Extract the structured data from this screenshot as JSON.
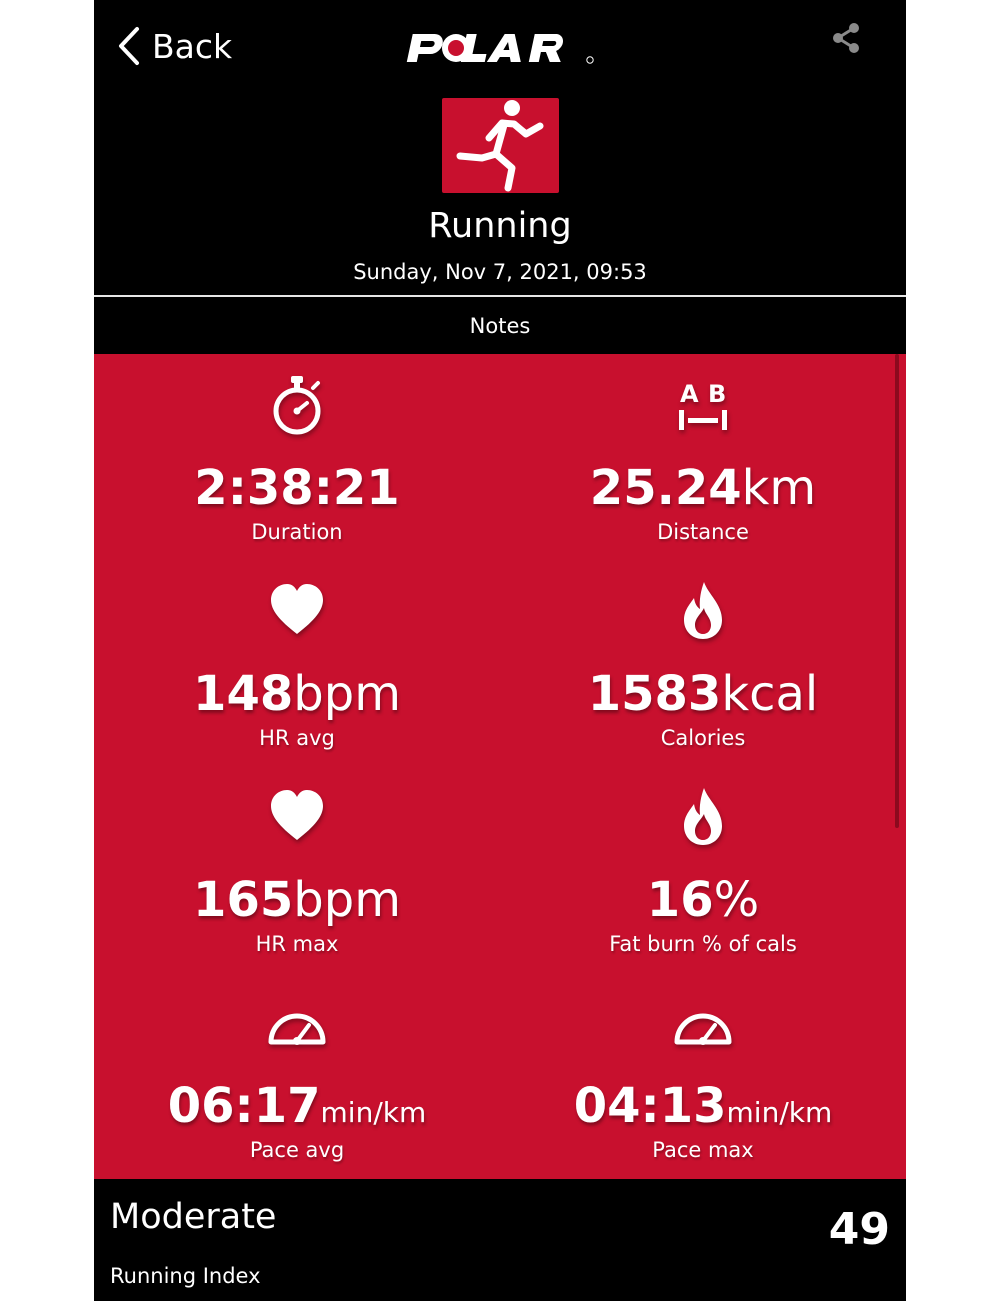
{
  "nav": {
    "back_label": "Back"
  },
  "brand": {
    "logo": "POLAR",
    "accent_color": "#c8102e"
  },
  "icons": {
    "back": "chevron-left-icon",
    "share": "share-icon",
    "sport": "running-icon"
  },
  "sport": {
    "title": "Running",
    "date": "Sunday, Nov 7, 2021, 09:53"
  },
  "notes_label": "Notes",
  "stats": [
    {
      "icon": "stopwatch-icon",
      "value": "2:38:21",
      "unit": "",
      "label": "Duration"
    },
    {
      "icon": "distance-ab-icon",
      "value": "25.24",
      "unit": "km",
      "label": "Distance"
    },
    {
      "icon": "heart-icon",
      "value": "148",
      "unit": "bpm",
      "label": "HR avg"
    },
    {
      "icon": "flame-icon",
      "value": "1583",
      "unit": "kcal",
      "label": "Calories"
    },
    {
      "icon": "heart-icon",
      "value": "165",
      "unit": "bpm",
      "label": "HR max"
    },
    {
      "icon": "flame-icon",
      "value": "16",
      "unit": "%",
      "label": "Fat burn % of cals"
    },
    {
      "icon": "speedometer-icon",
      "value": "06:17",
      "unit": "min/km",
      "label": "Pace avg"
    },
    {
      "icon": "speedometer-icon",
      "value": "04:13",
      "unit": "min/km",
      "label": "Pace max"
    }
  ],
  "running_index": {
    "level": "Moderate",
    "label": "Running Index",
    "value": "49"
  }
}
